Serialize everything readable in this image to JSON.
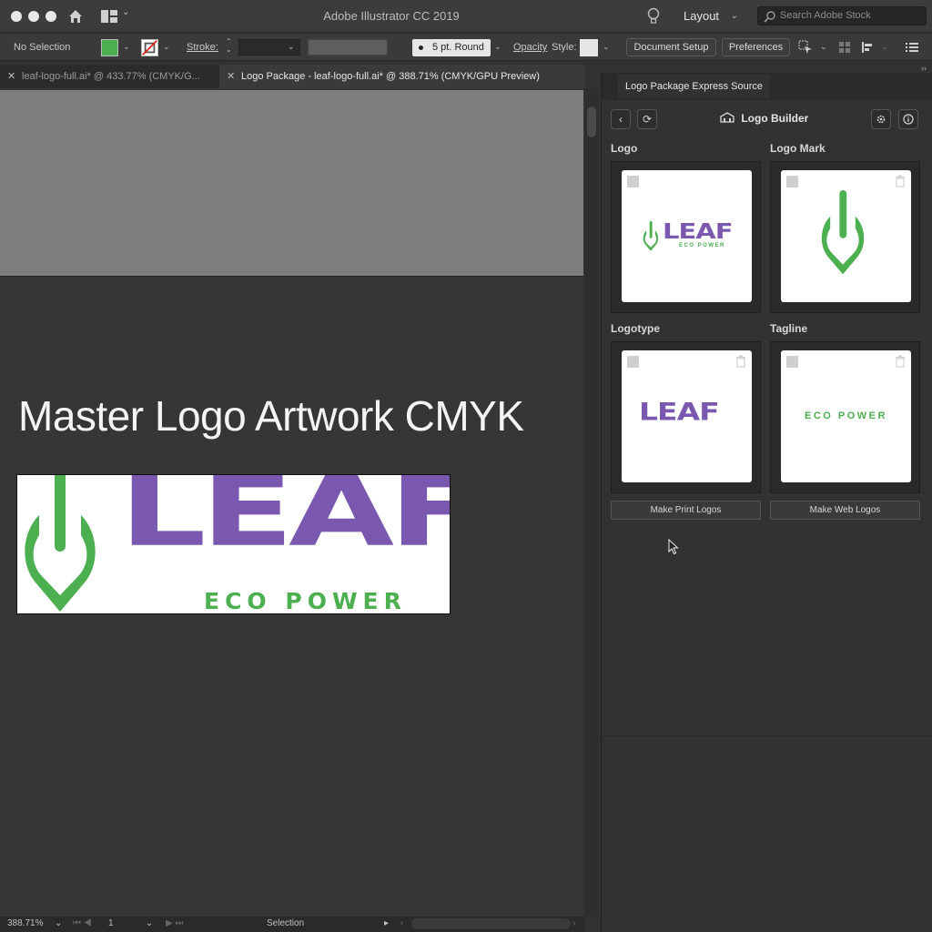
{
  "app": {
    "title": "Adobe Illustrator CC 2019",
    "workspace_label": "Layout",
    "search_placeholder": "Search Adobe Stock"
  },
  "controlbar": {
    "selection_label": "No Selection",
    "stroke_label": "Stroke:",
    "brush_label": "5 pt. Round",
    "opacity_label": "Opacity",
    "style_label": "Style:",
    "document_setup_label": "Document Setup",
    "preferences_label": "Preferences",
    "colors": {
      "fill": "#4caf50",
      "stroke_none": "#ffffff"
    }
  },
  "tabs": [
    {
      "label": "leaf-logo-full.ai* @ 433.77% (CMYK/G...",
      "active": false
    },
    {
      "label": "Logo Package - leaf-logo-full.ai* @ 388.71% (CMYK/GPU Preview)",
      "active": true
    }
  ],
  "canvas": {
    "heading": "Master Logo Artwork CMYK",
    "logo_word": "LEAF",
    "logo_tagline": "ECO POWER"
  },
  "statusbar": {
    "zoom": "388.71%",
    "artboard": "1",
    "tool": "Selection"
  },
  "panel": {
    "tab_label": "Logo Package Express Source",
    "title": "Logo Builder",
    "sections": {
      "logo": "Logo",
      "logo_mark": "Logo Mark",
      "logotype": "Logotype",
      "tagline": "Tagline"
    },
    "cards": {
      "logo_word": "LEAF",
      "logo_tagline": "ECO POWER",
      "logotype_word": "LEAF",
      "tagline_text": "ECO POWER"
    },
    "make_print_label": "Make Print Logos",
    "make_web_label": "Make Web Logos"
  },
  "brand_colors": {
    "green": "#4caf50",
    "purple": "#7a58b0"
  }
}
